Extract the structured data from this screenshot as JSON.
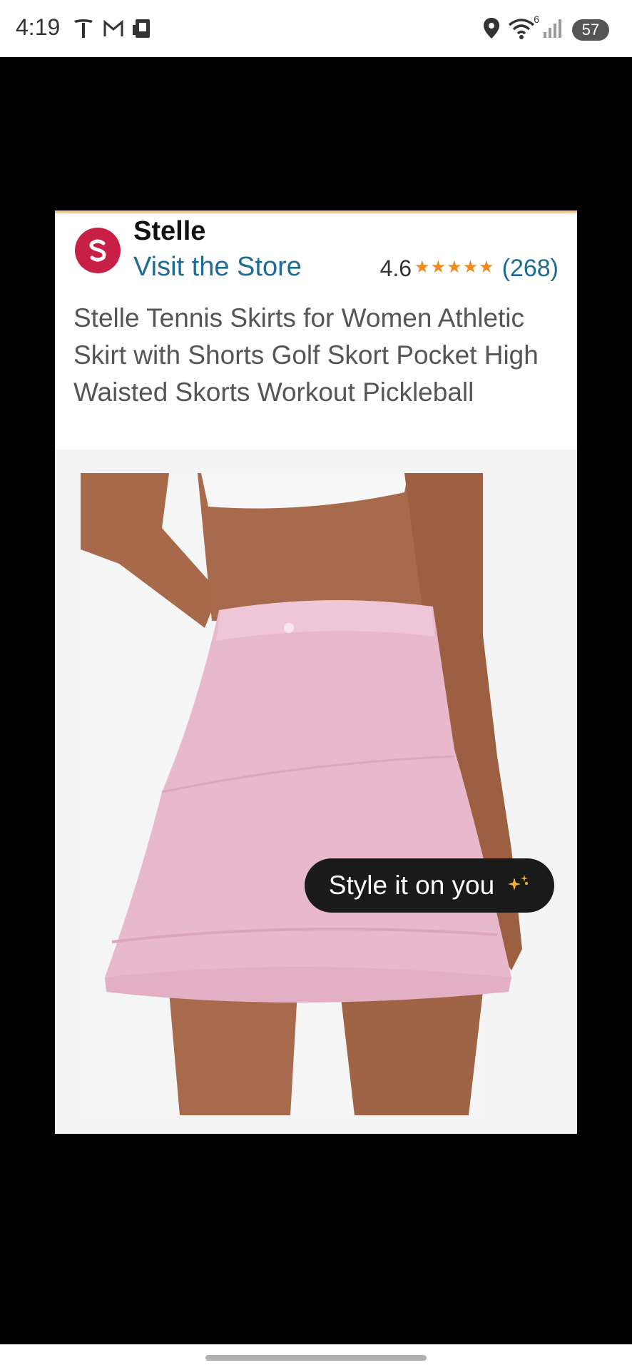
{
  "status_bar": {
    "time": "4:19",
    "left_icons": [
      "tesla-icon",
      "gmail-icon",
      "sim-icon"
    ],
    "right_icons": [
      "location-icon",
      "wifi-icon",
      "signal-icon"
    ],
    "wifi_label": "6",
    "battery": "57"
  },
  "product": {
    "brand": "Stelle",
    "visit_store": "Visit the Store",
    "rating": "4.6",
    "stars": "★★★★★",
    "review_count": "(268)",
    "title": "Stelle Tennis Skirts for Women Athletic Skirt with Shorts Golf Skort Pocket High Waisted Skorts Workout Pickleball",
    "style_button": "Style it on you"
  },
  "colors": {
    "brand_red": "#c81f45",
    "link_blue": "#1f6c93",
    "star_orange": "#f08a1a",
    "skirt_pink": "#e8b8cd",
    "skin": "#a86a4c"
  }
}
